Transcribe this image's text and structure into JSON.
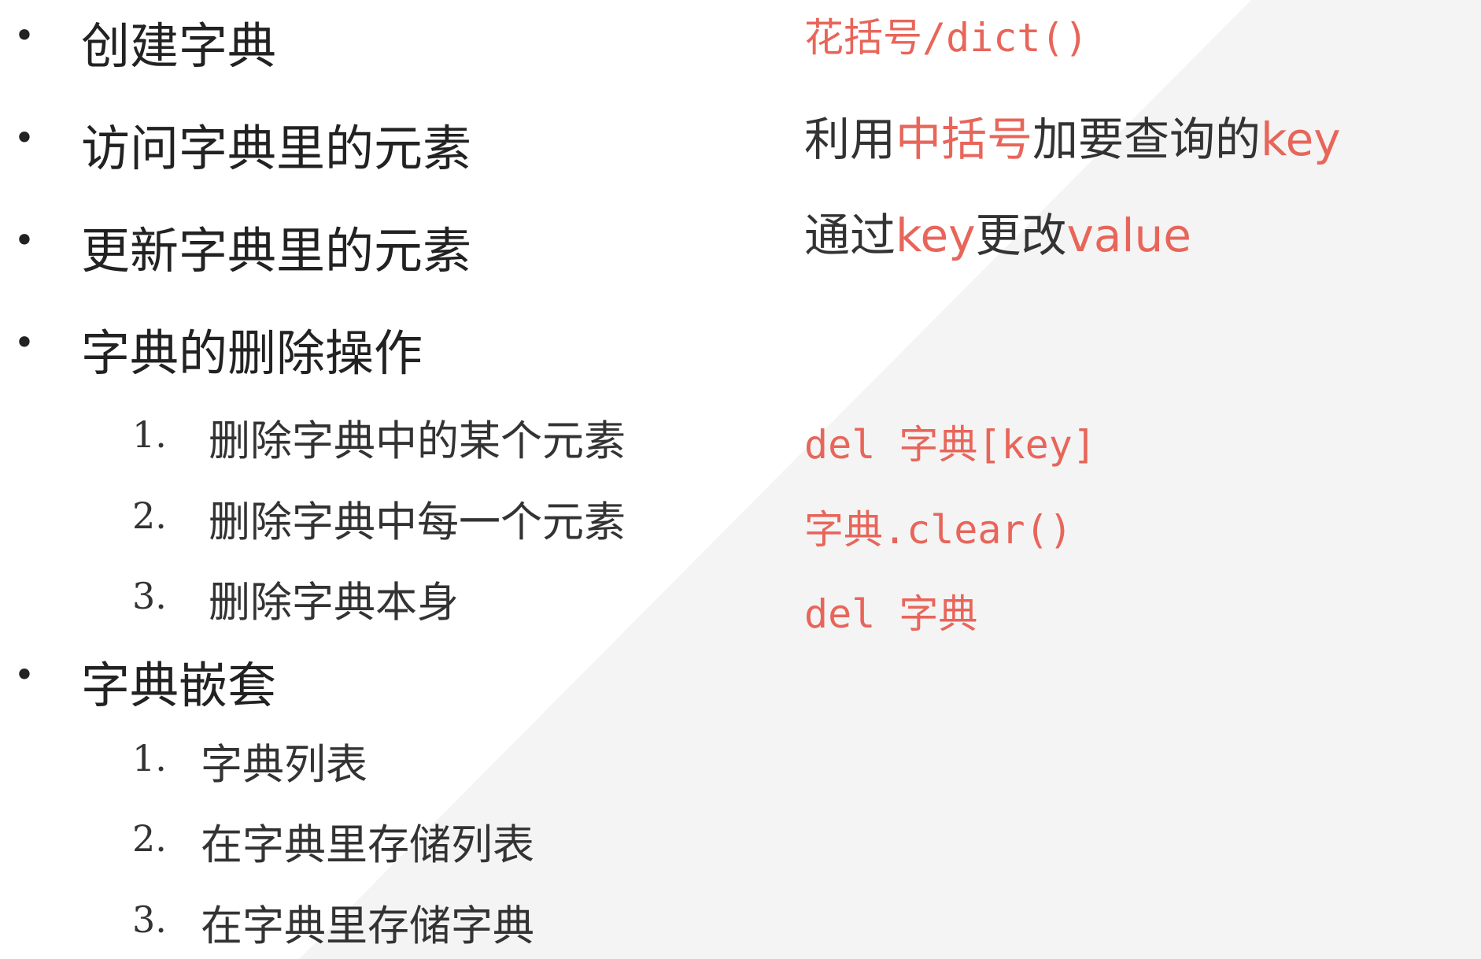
{
  "topics": [
    "创建字典",
    "访问字典里的元素",
    "更新字典里的元素",
    "字典的删除操作",
    "字典嵌套"
  ],
  "bullet_symbol": "•",
  "delete_subitems": [
    {
      "num": "1.",
      "label": "删除字典中的某个元素"
    },
    {
      "num": "2.",
      "label": "删除字典中每一个元素"
    },
    {
      "num": "3.",
      "label": "删除字典本身"
    }
  ],
  "nested_subitems": [
    {
      "num": "1.",
      "label": "字典列表"
    },
    {
      "num": "2.",
      "label": "在字典里存储列表"
    },
    {
      "num": "3.",
      "label": "在字典里存储字典"
    }
  ],
  "answers": {
    "create": "花括号/dict()",
    "access": {
      "prefix": "利用",
      "hl1": "中括号",
      "mid": "加要查询的",
      "hl2": "key"
    },
    "update": {
      "prefix": "通过",
      "hl1": "key",
      "mid": "更改",
      "hl2": "value"
    },
    "delete_one": "del 字典[key]",
    "delete_all": "字典.clear()",
    "delete_self": "del 字典"
  },
  "colors": {
    "accent": "#e8655a",
    "text": "#222222",
    "background": "#ffffff",
    "background_triangle": "#f4f4f4"
  }
}
